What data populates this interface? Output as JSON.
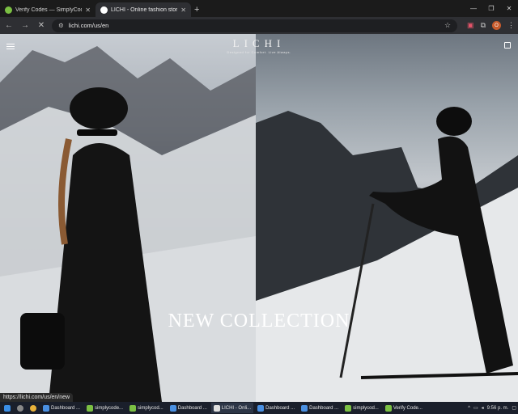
{
  "browser": {
    "tabs": [
      {
        "title": "Verify Codes — SimplyCodes",
        "active": false,
        "favicon_color": "#7bc043"
      },
      {
        "title": "LICHI - Online fashion store",
        "active": true,
        "favicon_color": "#ffffff"
      }
    ],
    "new_tab": "+",
    "url": "lichi.com/us/en",
    "profile_initial": "O",
    "status_url": "https://lichi.com/us/en/new"
  },
  "page": {
    "brand": "LICHI",
    "brand_tagline": "Designed for Comfort. Live Always.",
    "headline": "NEW COLLECTION"
  },
  "taskbar": {
    "items": [
      {
        "label": "Dashboard ...",
        "color": "#4a90e2"
      },
      {
        "label": "simplycode...",
        "color": "#7bc043"
      },
      {
        "label": "simplycod...",
        "color": "#7bc043"
      },
      {
        "label": "Dashboard ...",
        "color": "#4a90e2"
      },
      {
        "label": "LICHI - Onli...",
        "color": "#e0e0e0"
      },
      {
        "label": "Dashboard ...",
        "color": "#4a90e2"
      },
      {
        "label": "Dashboard ...",
        "color": "#4a90e2"
      },
      {
        "label": "simplycod...",
        "color": "#7bc043"
      },
      {
        "label": "Verify Code...",
        "color": "#7bc043"
      }
    ],
    "time": "9:56 p. m."
  }
}
